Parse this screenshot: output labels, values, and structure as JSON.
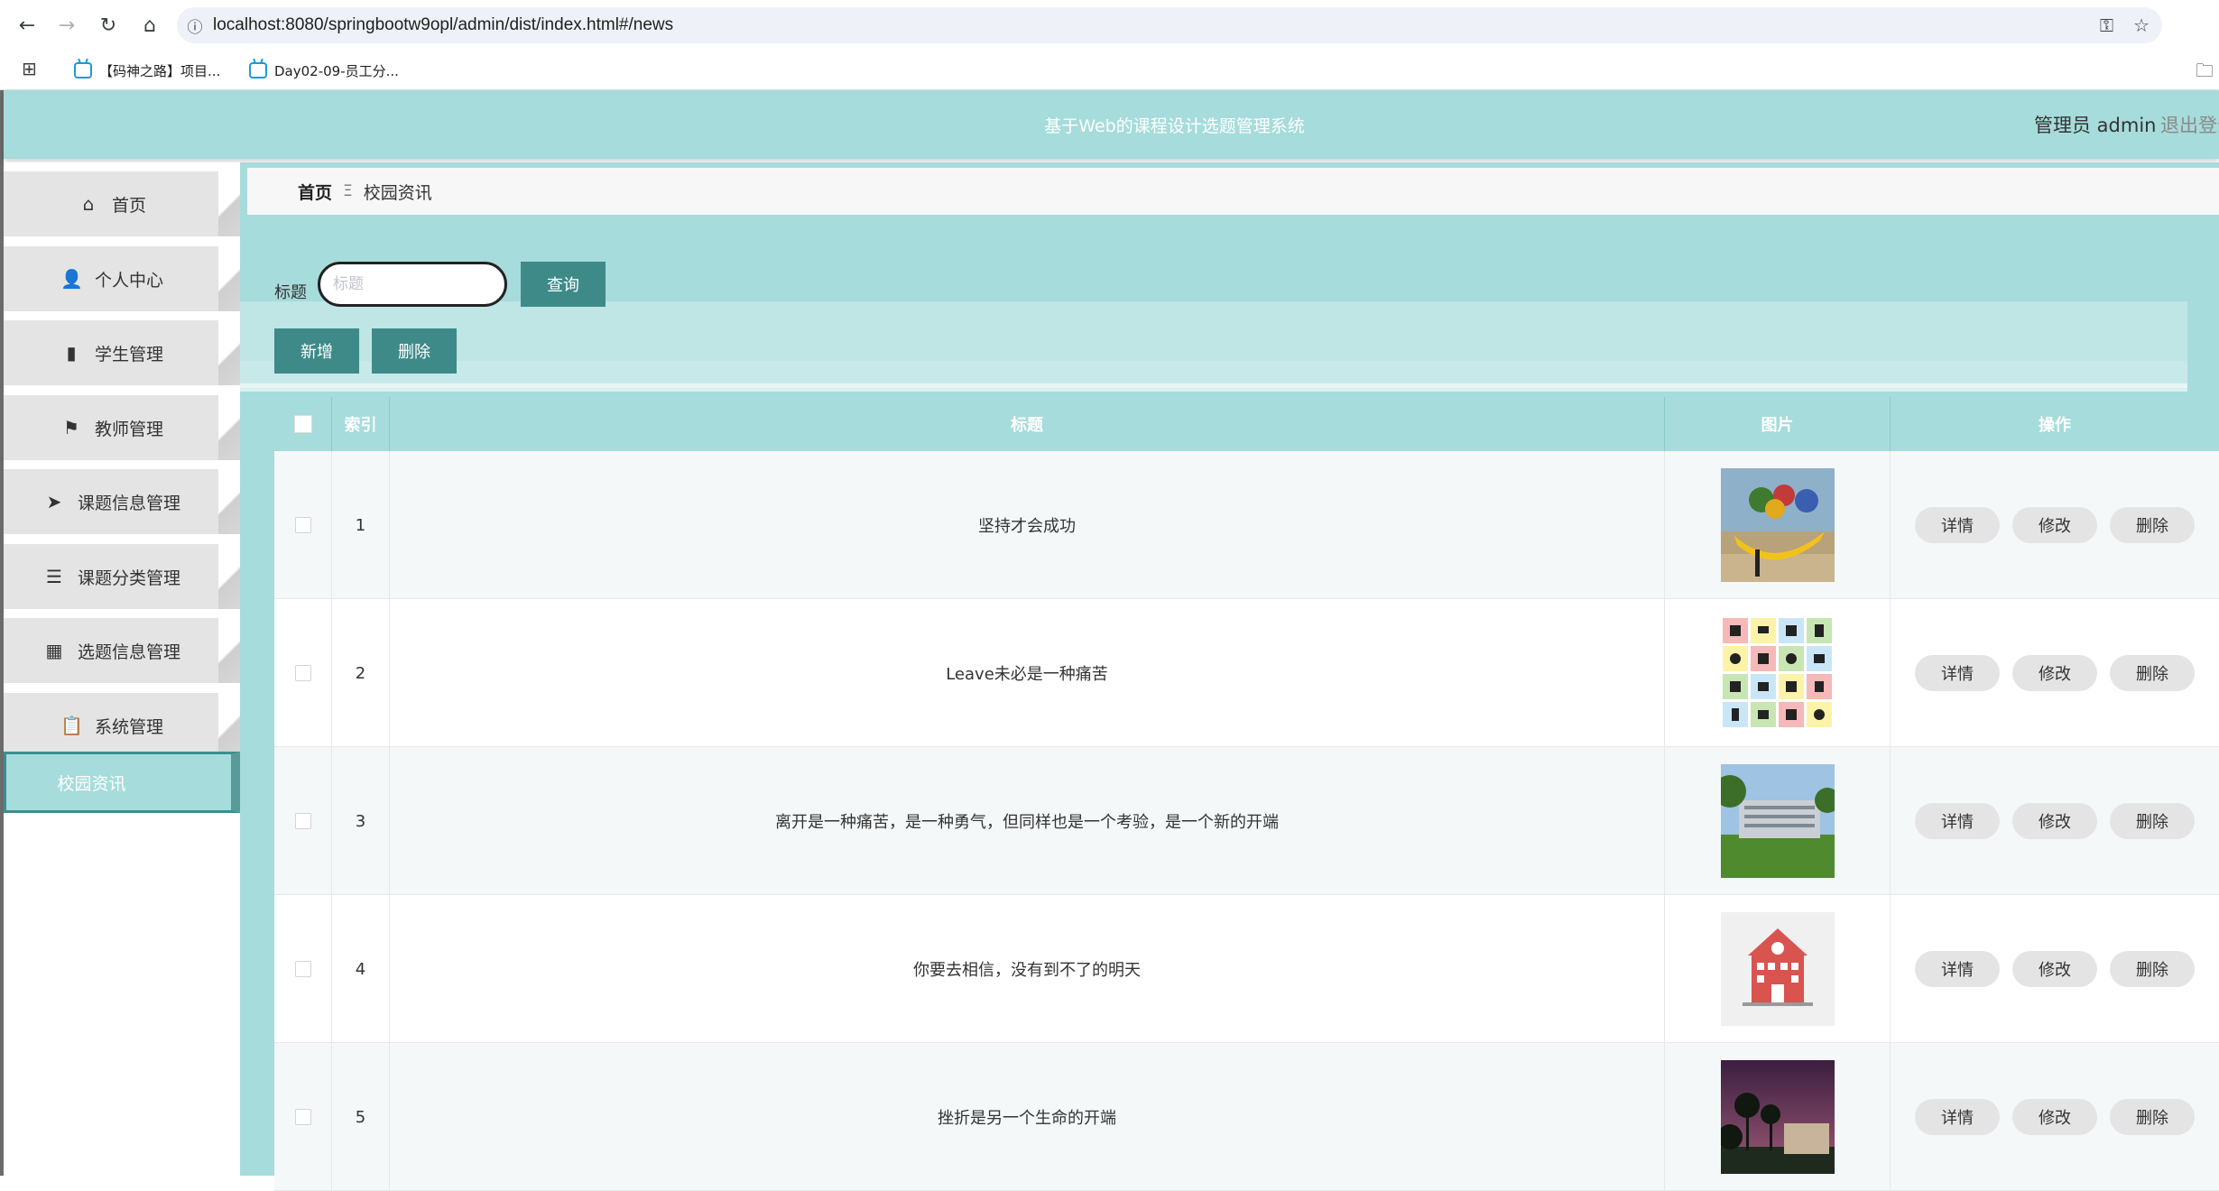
{
  "browser": {
    "url": "localhost:8080/springbootw9opl/admin/dist/index.html#/news",
    "bookmarks": [
      "【码神之路】项目...",
      "Day02-09-员工分..."
    ]
  },
  "header": {
    "title": "基于Web的课程设计选题管理系统",
    "user": "管理员 admin",
    "logout": "退出登录"
  },
  "sidebar": {
    "items": [
      {
        "label": "首页",
        "icon": "home-icon"
      },
      {
        "label": "个人中心",
        "icon": "user-icon"
      },
      {
        "label": "学生管理",
        "icon": "book-icon"
      },
      {
        "label": "教师管理",
        "icon": "flag-icon"
      },
      {
        "label": "课题信息管理",
        "icon": "send-icon"
      },
      {
        "label": "课题分类管理",
        "icon": "list-icon"
      },
      {
        "label": "选题信息管理",
        "icon": "grid-icon"
      },
      {
        "label": "系统管理",
        "icon": "clipboard-icon"
      },
      {
        "label": "校园资讯",
        "icon": ""
      }
    ]
  },
  "breadcrumb": {
    "home": "首页",
    "separator": "Ξ",
    "current": "校园资讯"
  },
  "search": {
    "label": "标题",
    "placeholder": "标题",
    "query_button": "查询",
    "add_button": "新增",
    "delete_button": "删除"
  },
  "table": {
    "columns": [
      "索引",
      "标题",
      "图片",
      "操作"
    ],
    "actions": [
      "详情",
      "修改",
      "删除"
    ],
    "rows": [
      {
        "index": "1",
        "title": "坚持才会成功",
        "image": "sculpture"
      },
      {
        "index": "2",
        "title": "Leave未必是一种痛苦",
        "image": "icon-grid"
      },
      {
        "index": "3",
        "title": "离开是一种痛苦，是一种勇气，但同样也是一个考验，是一个新的开端",
        "image": "campus-building"
      },
      {
        "index": "4",
        "title": "你要去相信，没有到不了的明天",
        "image": "school-illustration"
      },
      {
        "index": "5",
        "title": "挫折是另一个生命的开端",
        "image": "palm-night"
      }
    ]
  },
  "colors": {
    "accent": "#a6dcdb",
    "button": "#3e8a89"
  }
}
